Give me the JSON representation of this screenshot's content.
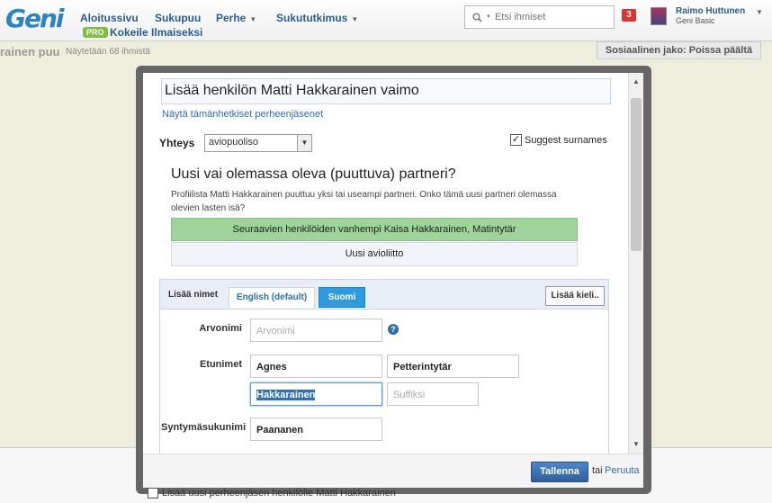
{
  "header": {
    "logo": "Geni",
    "nav": [
      {
        "label": "Aloitussivu",
        "dropdown": false
      },
      {
        "label": "Sukupuu",
        "dropdown": false
      },
      {
        "label": "Perhe",
        "dropdown": true
      },
      {
        "label": "Sukututkimus",
        "dropdown": true
      }
    ],
    "pro_badge": "PRO",
    "pro_text": "Kokeile Ilmaiseksi",
    "search_placeholder": "Etsi ihmiset",
    "notifications": "3",
    "user_name": "Raimo Huttunen",
    "user_plan": "Geni Basic"
  },
  "background": {
    "page_title": "rainen puu",
    "page_count": "Näytetään 68 ihmistä",
    "social_share": "Sosiaalinen jako: Poissa päältä",
    "bottom_checkbox_label": "Lisää uusi perheenjäsen henkilölle Matti Hakkarainen"
  },
  "modal": {
    "title": "Lisää henkilön Matti Hakkarainen vaimo",
    "show_family_link": "Näytä tämänhetkiset perheenjäsenet",
    "relationship_label": "Yhteys",
    "relationship_value": "aviopuoliso",
    "suggest_surnames_label": "Suggest surnames",
    "suggest_surnames_checked": true,
    "partner_heading": "Uusi vai olemassa oleva (puuttuva) partneri?",
    "partner_description": "Profiilista Matti Hakkarainen puuttuu yksi tai useampi partneri. Onko tämä uusi partneri olemassa olevien lasten isä?",
    "option_existing": "Seuraavien henkilöiden vanhempi Kaisa Hakkarainen, Matintytär",
    "option_new": "Uusi avioliitto",
    "names": {
      "section_label": "Lisää nimet",
      "tab_english": "English (default)",
      "tab_finnish": "Suomi",
      "add_language": "Lisää kieli..",
      "title_label": "Arvonimi",
      "title_placeholder": "Arvonimi",
      "first_label": "Etunimet",
      "first_value": "Agnes",
      "middle_value": "Petterintytär",
      "last_value": "Hakkarainen",
      "suffix_placeholder": "Suffiksi",
      "birth_surname_label": "Syntymäsukunimi",
      "birth_surname_value": "Paananen"
    },
    "save_label": "Tallenna",
    "or_text": "tai",
    "cancel_label": "Peruuta"
  },
  "colors": {
    "accent": "#2a6fb0",
    "option_existing_bg": "#9ed49a",
    "tab_active_bg": "#2e9be0",
    "notification_bg": "#dd3333"
  }
}
